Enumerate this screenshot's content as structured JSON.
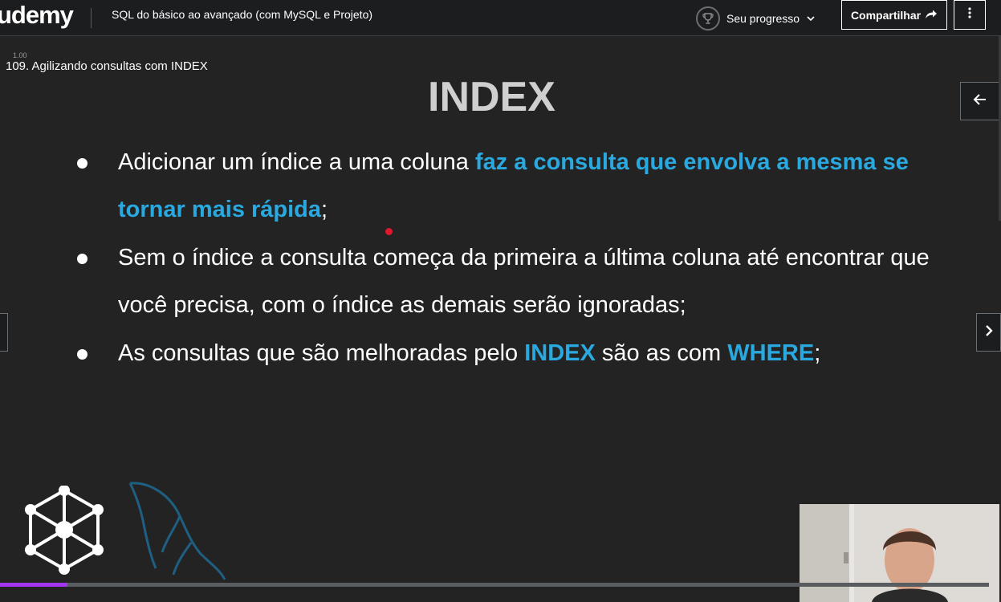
{
  "header": {
    "logo": "udemy",
    "course_title": "SQL do básico ao avançado (com MySQL e Projeto)",
    "progress_label": "Seu progresso",
    "share_label": "Compartilhar"
  },
  "video": {
    "speed_mark": "1.00",
    "lecture_title": "109. Agilizando consultas com INDEX",
    "progress_fraction": 0.068
  },
  "slide": {
    "heading": "INDEX",
    "bullets": [
      {
        "plain_a": "Adicionar um índice a uma coluna ",
        "highlight_a": "faz a consulta que envolva a mesma se tornar mais rápida",
        "plain_b": ";"
      },
      {
        "plain_a": "Sem o índice a consulta começa da primeira a última coluna até encontrar que você precisa, com o índice as demais serão ignoradas;"
      },
      {
        "plain_a": "As consultas que são melhoradas pelo ",
        "highlight_a": "INDEX",
        "plain_b": " são as com ",
        "highlight_b": "WHERE",
        "plain_c": ";"
      }
    ]
  },
  "colors": {
    "accent_blue": "#2aa9e0",
    "progress_purple": "#a435f0",
    "laser_red": "#e0172d"
  },
  "icons": {
    "trophy": "trophy-icon",
    "chevron": "chevron-down-icon",
    "share": "share-arrow-icon",
    "more": "more-vertical-icon",
    "collapse": "arrow-left-icon",
    "next": "chevron-right-icon"
  }
}
